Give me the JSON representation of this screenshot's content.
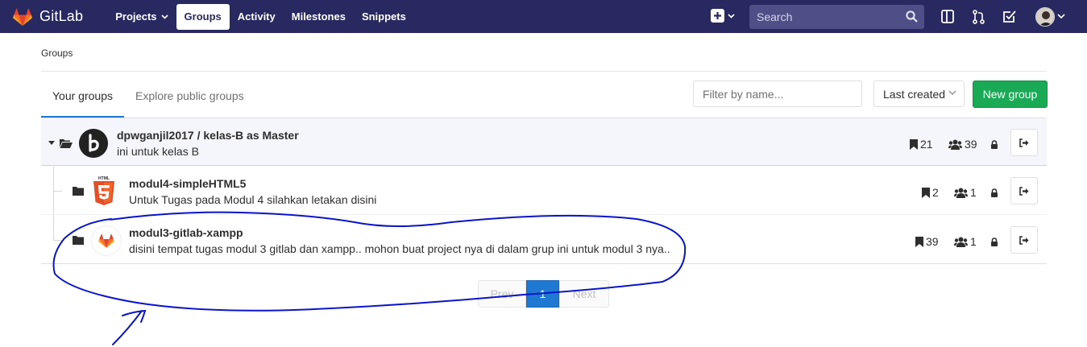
{
  "navbar": {
    "brand": "GitLab",
    "links": [
      {
        "label": "Projects",
        "has_caret": true
      },
      {
        "label": "Groups",
        "active": true
      },
      {
        "label": "Activity"
      },
      {
        "label": "Milestones"
      },
      {
        "label": "Snippets"
      }
    ],
    "search_placeholder": "Search",
    "colors": {
      "bar": "#292961",
      "search_bg": "#4f4f88"
    }
  },
  "breadcrumb": "Groups",
  "tabs": [
    {
      "label": "Your groups",
      "active": true
    },
    {
      "label": "Explore public groups"
    }
  ],
  "filter_placeholder": "Filter by name...",
  "sort": {
    "selected": "Last created"
  },
  "new_group_label": "New group",
  "groups": {
    "parent": {
      "title": "dpwganjil2017 / kelas-B as Master",
      "description": "ini untuk kelas B",
      "projects": "21",
      "members": "39",
      "avatar_icon": "b-logo-icon"
    },
    "children": [
      {
        "title": "modul4-simpleHTML5",
        "description": "Untuk Tugas pada Modul 4 silahkan letakan disini",
        "projects": "2",
        "members": "1",
        "avatar_icon": "html5-icon",
        "avatar_label": "HTML"
      },
      {
        "title": "modul3-gitlab-xampp",
        "description": "disini tempat tugas modul 3 gitlab dan xampp.. mohon buat project nya di dalam grup ini untuk modul 3 nya..",
        "projects": "39",
        "members": "1",
        "avatar_icon": "gitlab-fox-icon"
      }
    ]
  },
  "pagination": {
    "prev": "Prev",
    "current": "1",
    "next": "Next"
  },
  "annotation_color": "#0000c8"
}
